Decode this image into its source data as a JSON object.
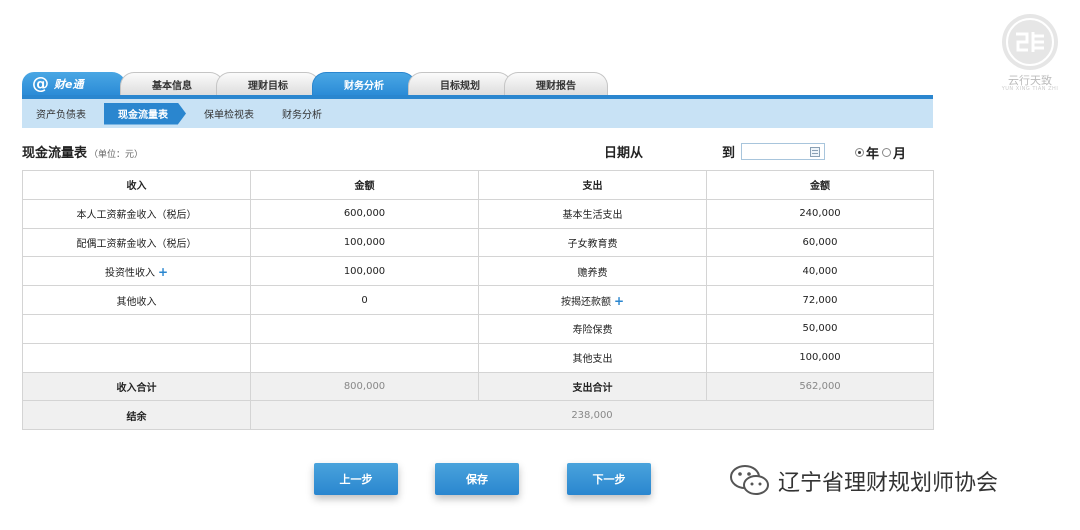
{
  "brand": {
    "logo_glyph": "@",
    "name": "财e通"
  },
  "tabs": [
    {
      "label": "基本信息",
      "active": false
    },
    {
      "label": "理财目标",
      "active": false
    },
    {
      "label": "财务分析",
      "active": true
    },
    {
      "label": "目标规划",
      "active": false
    },
    {
      "label": "理财报告",
      "active": false
    }
  ],
  "subnav": [
    {
      "label": "资产负债表",
      "active": false
    },
    {
      "label": "现金流量表",
      "active": true
    },
    {
      "label": "保单检视表",
      "active": false
    },
    {
      "label": "财务分析",
      "active": false
    }
  ],
  "sheet": {
    "title": "现金流量表",
    "unit": "（单位：元）"
  },
  "date_filter": {
    "from_label": "日期从",
    "to_label": "到",
    "to_value": "",
    "period_options": [
      "年",
      "月"
    ],
    "selected": "年"
  },
  "table": {
    "headers": [
      "收入",
      "金额",
      "支出",
      "金额"
    ],
    "rows": [
      {
        "income": "本人工资薪金收入（税后）",
        "income_amount": "600,000",
        "expense": "基本生活支出",
        "expense_amount": "240,000"
      },
      {
        "income": "配偶工资薪金收入（税后）",
        "income_amount": "100,000",
        "expense": "子女教育费",
        "expense_amount": "60,000"
      },
      {
        "income": "投资性收入",
        "income_amount": "100,000",
        "expense": "赡养费",
        "expense_amount": "40,000"
      },
      {
        "income": "其他收入",
        "income_amount": "0",
        "expense": "按揭还款额",
        "expense_amount": "72,000"
      },
      {
        "income": "",
        "income_amount": "",
        "expense": "寿险保费",
        "expense_amount": "50,000"
      },
      {
        "income": "",
        "income_amount": "",
        "expense": "其他支出",
        "expense_amount": "100,000"
      }
    ],
    "totals": {
      "income_label": "收入合计",
      "income_total": "800,000",
      "expense_label": "支出合计",
      "expense_total": "562,000"
    },
    "balance": {
      "label": "结余",
      "value": "238,000"
    }
  },
  "buttons": {
    "prev": "上一步",
    "save": "保存",
    "next": "下一步"
  },
  "watermark": {
    "text": "辽宁省理财规划师协会",
    "corner_label": "云行天致",
    "corner_sub": "YUN XING TIAN ZHI"
  },
  "colors": {
    "accent": "#2a86cf",
    "subnav_bg": "#c8e2f5",
    "total_bg": "#f0f0f0"
  }
}
